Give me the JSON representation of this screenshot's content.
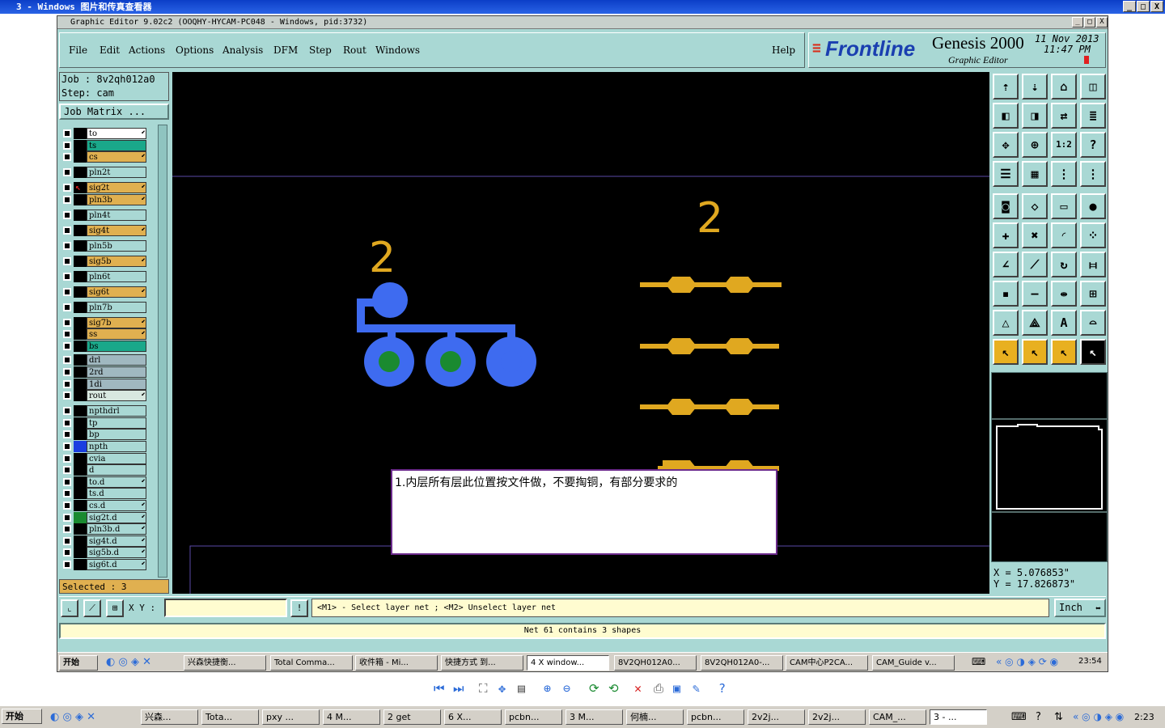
{
  "viewer": {
    "title": "3 - Windows 图片和传真查看器",
    "min_btn": "_",
    "max_btn": "□",
    "close_btn": "X"
  },
  "app": {
    "title": "Graphic Editor 9.02c2 (OOQHY-HYCAM-PC048 - Windows, pid:3732)",
    "menu": [
      "File",
      "Edit",
      "Actions",
      "Options",
      "Analysis",
      "DFM",
      "Step",
      "Rout",
      "Windows"
    ],
    "help": "Help",
    "brand_logo": "Frontline",
    "brand_product": "Genesis 2000",
    "brand_sub": "Graphic Editor",
    "date": "11 Nov 2013",
    "time": "11:47 PM"
  },
  "job": {
    "job_label": "Job : 8v2qh012a0",
    "step_label": "Step: cam",
    "matrix_button": "Job Matrix ..."
  },
  "layers": [
    {
      "name": "to",
      "color": "#ffffff",
      "edit": true
    },
    {
      "name": "ts",
      "color": "#1aa88a",
      "edit": false
    },
    {
      "name": "cs",
      "color": "#e0b050",
      "edit": true
    },
    {
      "name": "pln2t",
      "color": "#a9d8d4",
      "edit": false
    },
    {
      "name": "sig2t",
      "color": "#e0b050",
      "edit": true
    },
    {
      "name": "pln3b",
      "color": "#e0b050",
      "edit": true
    },
    {
      "name": "pln4t",
      "color": "#a9d8d4",
      "edit": false
    },
    {
      "name": "sig4t",
      "color": "#e0b050",
      "edit": true
    },
    {
      "name": "pln5b",
      "color": "#a9d8d4",
      "edit": false
    },
    {
      "name": "sig5b",
      "color": "#e0b050",
      "edit": true
    },
    {
      "name": "pln6t",
      "color": "#a9d8d4",
      "edit": false
    },
    {
      "name": "sig6t",
      "color": "#e0b050",
      "edit": true
    },
    {
      "name": "pln7b",
      "color": "#a9d8d4",
      "edit": false
    },
    {
      "name": "sig7b",
      "color": "#e0b050",
      "edit": true
    },
    {
      "name": "ss",
      "color": "#e0b050",
      "edit": true
    },
    {
      "name": "bs",
      "color": "#1aa88a",
      "edit": false
    },
    {
      "name": "drl",
      "color": "#a0b8c0",
      "edit": false
    },
    {
      "name": "2rd",
      "color": "#a0b8c0",
      "edit": false
    },
    {
      "name": "1di",
      "color": "#a0b8c0",
      "edit": false
    },
    {
      "name": "rout",
      "color": "#d8e8e0",
      "edit": true
    },
    {
      "name": "npthdrl",
      "color": "#a9d8d4",
      "edit": false
    },
    {
      "name": "tp",
      "color": "#a9d8d4",
      "edit": false
    },
    {
      "name": "bp",
      "color": "#a9d8d4",
      "edit": false
    },
    {
      "name": "npth",
      "color": "#a9d8d4",
      "edit": false
    },
    {
      "name": "cvia",
      "color": "#a9d8d4",
      "edit": false
    },
    {
      "name": "d",
      "color": "#a9d8d4",
      "edit": false
    },
    {
      "name": "to.d",
      "color": "#a9d8d4",
      "edit": true
    },
    {
      "name": "ts.d",
      "color": "#a9d8d4",
      "edit": false
    },
    {
      "name": "cs.d",
      "color": "#a9d8d4",
      "edit": true
    },
    {
      "name": "sig2t.d",
      "color": "#a9d8d4",
      "edit": true
    },
    {
      "name": "pln3b.d",
      "color": "#a9d8d4",
      "edit": true
    },
    {
      "name": "sig4t.d",
      "color": "#a9d8d4",
      "edit": true
    },
    {
      "name": "sig5b.d",
      "color": "#a9d8d4",
      "edit": true
    },
    {
      "name": "sig6t.d",
      "color": "#a9d8d4",
      "edit": true
    }
  ],
  "selected_label": "Selected : 3",
  "canvas": {
    "net_number": "2",
    "annotation": "1.内层所有层此位置按文件做，不要掏铜，有部分要求的"
  },
  "coords": {
    "x": "X = 5.076853\"",
    "y": "Y = 17.826873\""
  },
  "cmd": {
    "xy_label": "X Y :",
    "hint": "<M1> - Select layer net ; <M2> Unselect layer net",
    "unit": "Inch",
    "net_status": "Net 61 contains 3 shapes"
  },
  "inner_taskbar": {
    "start": "开始",
    "items": [
      "兴森快捷衡...",
      "Total Comma...",
      "收件箱 - Mi...",
      "快捷方式 到...",
      "4 X window...",
      "8V2QH012A0...",
      "8V2QH012A0-...",
      "CAM中心P2CA...",
      "CAM_Guide v..."
    ],
    "clock": "23:54"
  },
  "taskbar": {
    "start": "开始",
    "items": [
      "兴森...",
      "Tota...",
      "pxy ...",
      "4 M...",
      "2 get",
      "6 X...",
      "pcbn...",
      "3 M...",
      "何楠...",
      "pcbn...",
      "2v2j...",
      "2v2j...",
      "CAM_...",
      "3 - ..."
    ],
    "clock": "2:23"
  }
}
